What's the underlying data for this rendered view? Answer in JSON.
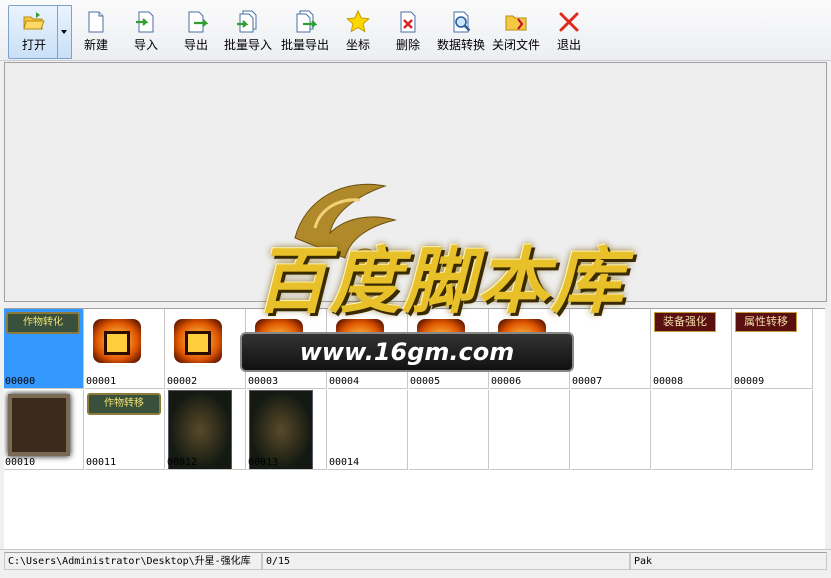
{
  "toolbar": {
    "open": "打开",
    "new": "新建",
    "import": "导入",
    "export": "导出",
    "batch_import": "批量导入",
    "batch_export": "批量导出",
    "coord": "坐标",
    "delete": "删除",
    "convert": "数据转换",
    "close_file": "关闭文件",
    "exit": "退出"
  },
  "cells": [
    "00000",
    "00001",
    "00002",
    "00003",
    "00004",
    "00005",
    "00006",
    "00007",
    "00008",
    "00009",
    "00010",
    "00011",
    "00012",
    "00013",
    "00014"
  ],
  "thumb_text": {
    "banner_a": "作物转化",
    "banner_b": "作物转移",
    "tag_a": "装备强化",
    "tag_b": "属性转移"
  },
  "watermark": {
    "title": "百度脚本库",
    "url": "www.16gm.com"
  },
  "status": {
    "path": "C:\\Users\\Administrator\\Desktop\\升星-强化库",
    "count": "0/15",
    "type": "Pak"
  },
  "colors": {
    "selection": "#3399ff",
    "accent": "#d6a500"
  }
}
